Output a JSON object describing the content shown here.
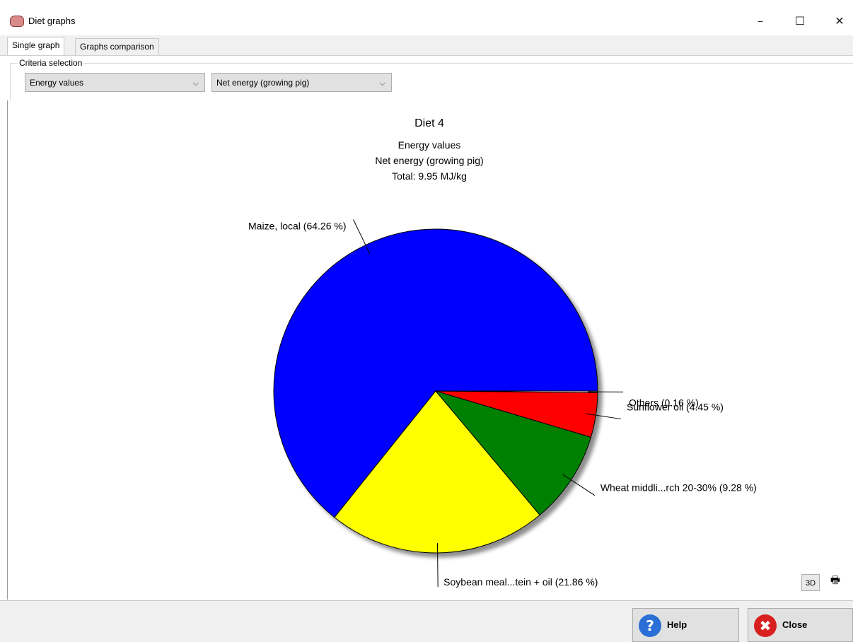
{
  "window": {
    "title": "Diet graphs",
    "minimize_glyph": "–",
    "maximize_glyph": "☐",
    "close_glyph": "✕"
  },
  "tabs": [
    {
      "label": "Single graph",
      "active": true
    },
    {
      "label": "Graphs comparison",
      "active": false
    }
  ],
  "criteria": {
    "legend": "Criteria selection",
    "category": "Energy values",
    "criterion": "Net energy (growing pig)"
  },
  "chart_data": {
    "type": "pie",
    "title": "Diet 4",
    "subtitle_lines": [
      "Energy values",
      "Net energy (growing pig)",
      "Total: 9.95 MJ/kg"
    ],
    "slices": [
      {
        "label": "Maize, local (64.26 %)",
        "value": 64.26,
        "color": "#0000ff"
      },
      {
        "label": "Soybean meal...tein + oil (21.86 %)",
        "value": 21.86,
        "color": "#ffff00"
      },
      {
        "label": "Wheat middli...rch 20-30% (9.28 %)",
        "value": 9.28,
        "color": "#008000"
      },
      {
        "label": "Sunflower oil (4.45 %)",
        "value": 4.45,
        "color": "#ff0000"
      },
      {
        "label": "Others (0.16 %)",
        "value": 0.16,
        "color": "#ffffff"
      }
    ],
    "start_angle": "3 o'clock, counter-clockwise",
    "shadow": true
  },
  "tools": {
    "three_d_label": "3D",
    "print_icon": "printer-icon"
  },
  "footer": {
    "help_label": "Help",
    "close_label": "Close",
    "help_icon": "help-icon",
    "close_icon": "close-icon"
  }
}
